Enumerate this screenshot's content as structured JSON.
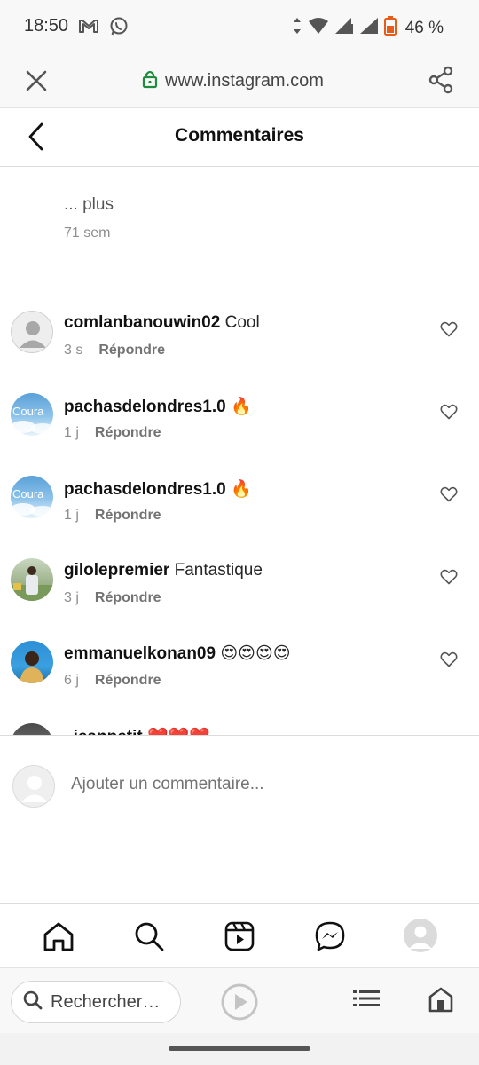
{
  "status_bar": {
    "time": "18:50",
    "battery": "46 %",
    "icons": [
      "gmail-icon",
      "whatsapp-icon",
      "data-arrows-icon",
      "wifi-icon",
      "signal-icon",
      "signal-icon",
      "battery-icon"
    ]
  },
  "browser": {
    "url": "www.instagram.com",
    "icons": [
      "close-icon",
      "lock-icon",
      "share-icon"
    ],
    "search_placeholder": "Rechercher…"
  },
  "header": {
    "title": "Commentaires"
  },
  "caption": {
    "more": "... plus",
    "time": "71 sem"
  },
  "comments": [
    {
      "user": "comlanbanouwin02",
      "text": "Cool",
      "time": "3 s",
      "reply": "Répondre"
    },
    {
      "user": "pachasdelondres1.0",
      "text": "🔥",
      "time": "1 j",
      "reply": "Répondre"
    },
    {
      "user": "pachasdelondres1.0",
      "text": "🔥",
      "time": "1 j",
      "reply": "Répondre"
    },
    {
      "user": "gilolepremier",
      "text": "Fantastique",
      "time": "3 j",
      "reply": "Répondre"
    },
    {
      "user": "emmanuelkonan09",
      "text": "😍😍😍😍",
      "time": "6 j",
      "reply": "Répondre"
    },
    {
      "user": "_jeanpetit",
      "text": "❤️❤️❤️",
      "time": "",
      "reply": ""
    }
  ],
  "add_comment": {
    "placeholder": "Ajouter un commentaire..."
  },
  "bottom_nav": {
    "items": [
      "home-icon",
      "search-icon",
      "reels-icon",
      "messenger-icon",
      "profile-avatar"
    ]
  },
  "colors": {
    "lock_green": "#1e8e3e",
    "text_primary": "#262626",
    "text_secondary": "#8e8e8e",
    "divider": "#dbdbdb"
  }
}
